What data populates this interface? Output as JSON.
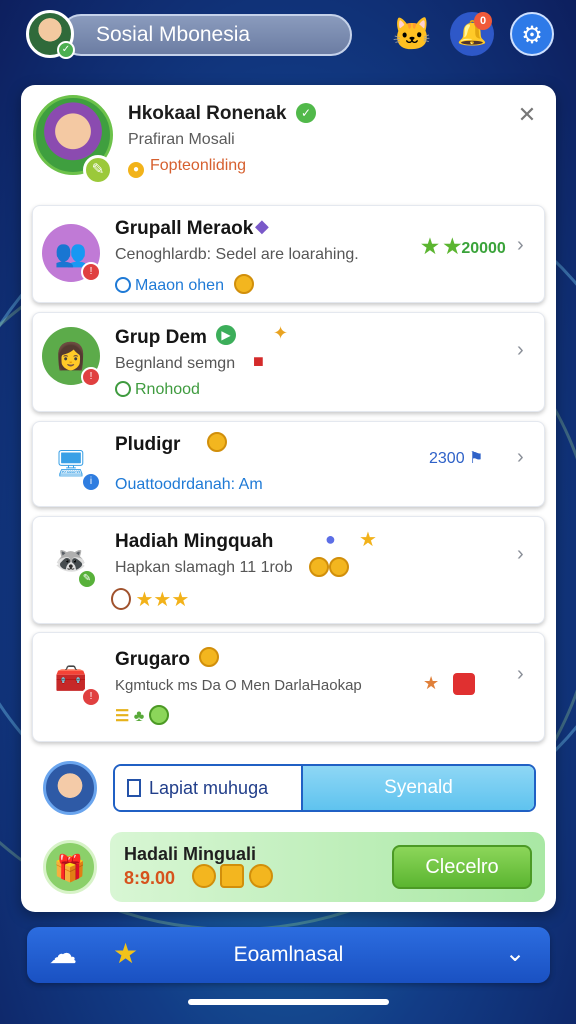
{
  "header": {
    "title": "Sosial Mbonesia",
    "notification_count": "0",
    "icons": [
      "cat-mascot-icon",
      "bell-icon",
      "gear-icon"
    ]
  },
  "profile": {
    "name": "Hkokaal Ronenak",
    "subtitle": "Prafiran Mosali",
    "status": "Fopteonliding"
  },
  "cards": [
    {
      "title": "Grupall Meraok",
      "subtitle": "Cenoghlardb: Sedel are loarahing.",
      "meta": "Maaon ohen",
      "right": "20000",
      "meta_color": "#1f7ad6",
      "right_color": "#3aa33a"
    },
    {
      "title": "Grup Dem",
      "subtitle": "Begnland semgn",
      "meta": "Rnohood",
      "right": "",
      "meta_color": "#3f9b3f",
      "right_color": "#3aa33a"
    },
    {
      "title": "Pludigr",
      "subtitle": "",
      "meta": "Ouattoodrdanah: Am",
      "right": "2300",
      "meta_color": "#1f7ad6",
      "right_color": "#2f62c8"
    },
    {
      "title": "Hadiah Mingquah",
      "subtitle": "Hapkan slamagh 11 1rob",
      "meta": "",
      "right": "",
      "meta_color": "#d6531d",
      "right_color": "#2f62c8"
    },
    {
      "title": "Grugaro",
      "subtitle": "Kgmtuck ms Da O Men DarlaHaokap",
      "meta": "",
      "right": "",
      "meta_color": "#3f9b3f",
      "right_color": "#2f62c8"
    }
  ],
  "search": {
    "left_label": "Lapiat muhuga",
    "right_label": "Syenald"
  },
  "reward": {
    "title": "Hadali Minguali",
    "amount": "8:9.00",
    "button": "Clecelro"
  },
  "bottom_nav": {
    "label": "Eoamlnasal",
    "icons": [
      "cloud-shop-icon",
      "star-icon",
      "chevron-down-icon"
    ]
  },
  "colors": {
    "accent": "#2c6de0",
    "panel": "#ffffff",
    "reward_button": "#5bb530"
  }
}
